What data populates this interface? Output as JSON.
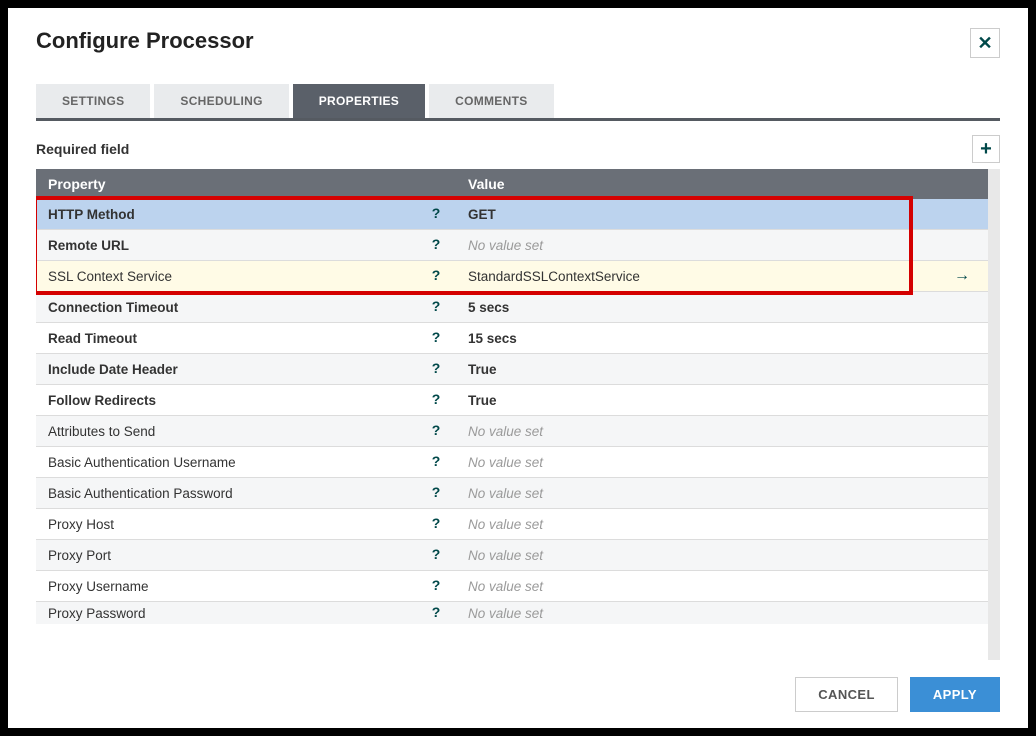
{
  "dialog": {
    "title": "Configure Processor",
    "close": "✕"
  },
  "tabs": {
    "settings": "SETTINGS",
    "scheduling": "SCHEDULING",
    "properties": "PROPERTIES",
    "comments": "COMMENTS",
    "active": "properties"
  },
  "required_label": "Required field",
  "add_icon": "+",
  "columns": {
    "property": "Property",
    "value": "Value"
  },
  "no_value": "No value set",
  "help_glyph": "?",
  "goto_glyph": "→",
  "rows": [
    {
      "name": "HTTP Method",
      "value": "GET",
      "required": true,
      "selected": true
    },
    {
      "name": "Remote URL",
      "value": null,
      "required": true
    },
    {
      "name": "SSL Context Service",
      "value": "StandardSSLContextService",
      "required": false,
      "yellow": true,
      "goto": true
    },
    {
      "name": "Connection Timeout",
      "value": "5 secs",
      "required": true
    },
    {
      "name": "Read Timeout",
      "value": "15 secs",
      "required": true
    },
    {
      "name": "Include Date Header",
      "value": "True",
      "required": true
    },
    {
      "name": "Follow Redirects",
      "value": "True",
      "required": true
    },
    {
      "name": "Attributes to Send",
      "value": null,
      "required": false
    },
    {
      "name": "Basic Authentication Username",
      "value": null,
      "required": false
    },
    {
      "name": "Basic Authentication Password",
      "value": null,
      "required": false
    },
    {
      "name": "Proxy Host",
      "value": null,
      "required": false
    },
    {
      "name": "Proxy Port",
      "value": null,
      "required": false
    },
    {
      "name": "Proxy Username",
      "value": null,
      "required": false
    },
    {
      "name": "Proxy Password",
      "value": null,
      "required": false,
      "cut": true
    }
  ],
  "buttons": {
    "cancel": "CANCEL",
    "apply": "APPLY"
  }
}
